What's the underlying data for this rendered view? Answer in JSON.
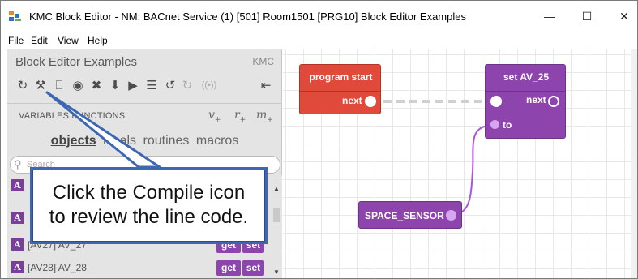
{
  "window": {
    "title": "KMC Block Editor - NM: BACnet Service (1) [501] Room1501 [PRG10] Block Editor Examples",
    "minimize": "—",
    "maximize": "☐",
    "close": "✕"
  },
  "menu": [
    "File",
    "Edit",
    "View",
    "Help"
  ],
  "panel": {
    "title": "Block Editor Examples",
    "brand": "KMC",
    "toolbar_icons": [
      "refresh-icon",
      "compile-icon",
      "save-icon",
      "stop-icon",
      "delete-icon",
      "download-icon",
      "run-icon",
      "text-view-icon",
      "undo-icon",
      "redo-icon",
      "broadcast-icon",
      "collapse-icon"
    ],
    "toolbar_glyphs": [
      "↻",
      "⚒",
      "⎕",
      "◉",
      "✖",
      "⬇",
      "▶",
      "☰",
      "↺",
      "↻",
      "((•))",
      "⇤"
    ],
    "variables_label": "VARIABLES FUNCTIONS",
    "var_symbols": [
      {
        "sym": "v",
        "sub": "+"
      },
      {
        "sym": "r",
        "sub": "+"
      },
      {
        "sym": "m",
        "sub": "+"
      }
    ],
    "tabs": [
      "objects",
      "locals",
      "routines",
      "macros"
    ],
    "active_tab": "objects",
    "search_placeholder": "Search",
    "rows": [
      {
        "badge": "A",
        "text": "",
        "get": "get",
        "set": "set"
      },
      {
        "badge": "A",
        "text": "",
        "get": "get",
        "set": "set"
      },
      {
        "badge": "A",
        "text": "[AV27] AV_27",
        "get": "get",
        "set": "set"
      },
      {
        "badge": "A",
        "text": "[AV28] AV_28",
        "get": "get",
        "set": "set"
      }
    ]
  },
  "workspace": {
    "blocks": {
      "program_start": {
        "title": "program start",
        "port_label": "next",
        "color": "#e04a3b"
      },
      "set_av": {
        "title": "set AV_25",
        "next_label": "next",
        "to_label": "to",
        "color": "#8e44ad"
      },
      "sensor": {
        "title": "SPACE_SENSOR",
        "color": "#8e44ad"
      }
    }
  },
  "callout": {
    "line1": "Click the Compile icon",
    "line2": "to review the line code."
  }
}
